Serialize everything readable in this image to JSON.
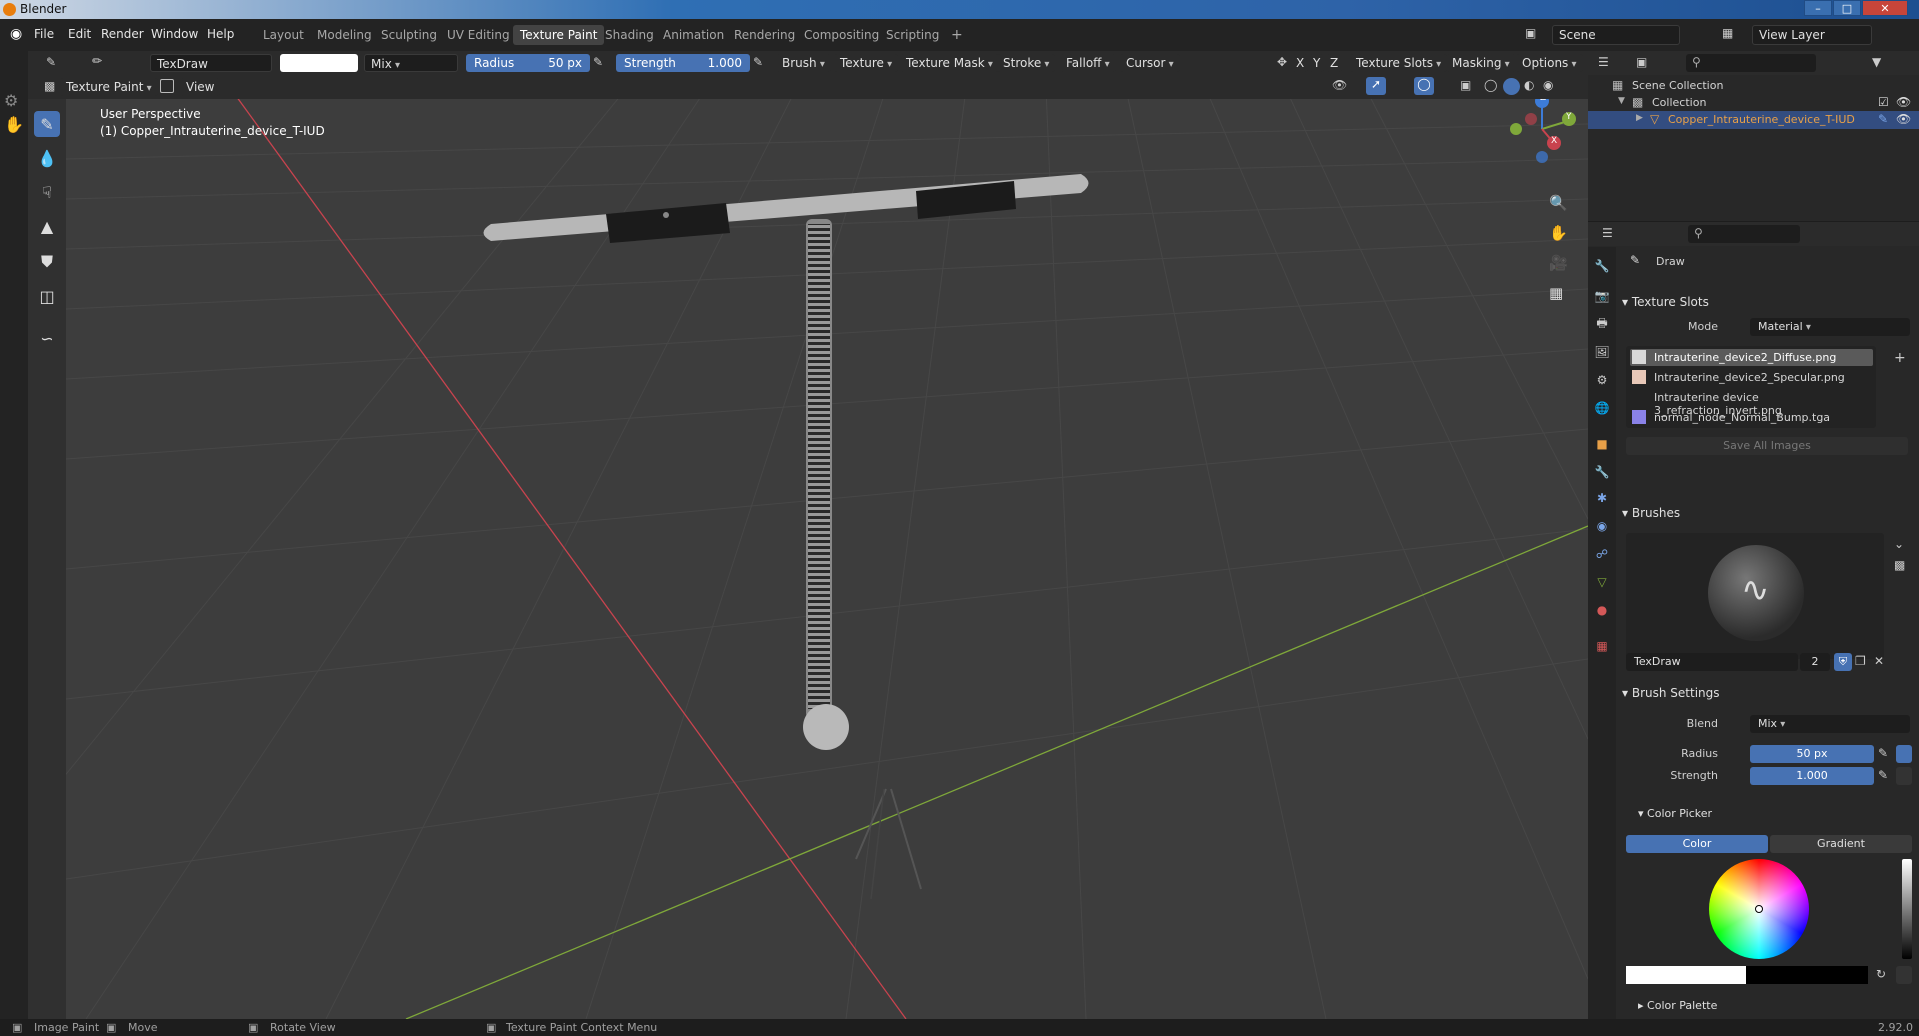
{
  "window": {
    "title": "Blender",
    "controls": [
      "–",
      "□",
      "✕"
    ]
  },
  "menu": {
    "items": [
      "File",
      "Edit",
      "Render",
      "Window",
      "Help"
    ]
  },
  "workspaces": [
    "Layout",
    "Modeling",
    "Sculpting",
    "UV Editing",
    "Texture Paint",
    "Shading",
    "Animation",
    "Rendering",
    "Compositing",
    "Scripting"
  ],
  "workspace_add": "+",
  "scene": {
    "label": "Scene",
    "view_layer": "View Layer"
  },
  "toolbar": {
    "brush_name": "TexDraw",
    "blend": "Mix",
    "radius_label": "Radius",
    "radius_value": "50 px",
    "strength_label": "Strength",
    "strength_value": "1.000",
    "menus": [
      "Brush",
      "Texture",
      "Texture Mask",
      "Stroke",
      "Falloff",
      "Cursor"
    ],
    "axes": [
      "X",
      "Y",
      "Z"
    ],
    "right_menus": [
      "Texture Slots",
      "Masking",
      "Options"
    ]
  },
  "header2": {
    "mode": "Texture Paint",
    "view": "View"
  },
  "viewport": {
    "perspective": "User Perspective",
    "object": "(1) Copper_Intrauterine_device_T-IUD",
    "gizmo_axes": [
      "Z",
      "Y",
      "X"
    ]
  },
  "outliner": {
    "scene_collection": "Scene Collection",
    "collection": "Collection",
    "object": "Copper_Intrauterine_device_T-IUD"
  },
  "properties": {
    "tool_name": "Draw",
    "texture_slots": {
      "header": "Texture Slots",
      "mode_label": "Mode",
      "mode_value": "Material",
      "items": [
        "Intrauterine_device2_Diffuse.png",
        "Intrauterine_device2_Specular.png",
        "Intrauterine device 3_refraction_invert.png",
        "normal_node_Normal_Bump.tga"
      ],
      "save_all": "Save All Images"
    },
    "brushes": {
      "header": "Brushes",
      "name": "TexDraw",
      "users": "2"
    },
    "brush_settings": {
      "header": "Brush Settings",
      "blend_label": "Blend",
      "blend_value": "Mix",
      "radius_label": "Radius",
      "radius_value": "50 px",
      "strength_label": "Strength",
      "strength_value": "1.000"
    },
    "color_picker": {
      "header": "Color Picker",
      "tab_color": "Color",
      "tab_gradient": "Gradient"
    },
    "color_palette": "Color Palette"
  },
  "status": {
    "items": [
      "Image Paint",
      "Move",
      "Rotate View",
      "Texture Paint Context Menu"
    ],
    "version": "2.92.0"
  },
  "colors": {
    "accent": "#4772b3",
    "background": "#3d3d3d",
    "panel": "#282828",
    "x_axis": "#c8434e",
    "y_axis": "#7fa83a",
    "z_axis": "#3d7cd8"
  }
}
